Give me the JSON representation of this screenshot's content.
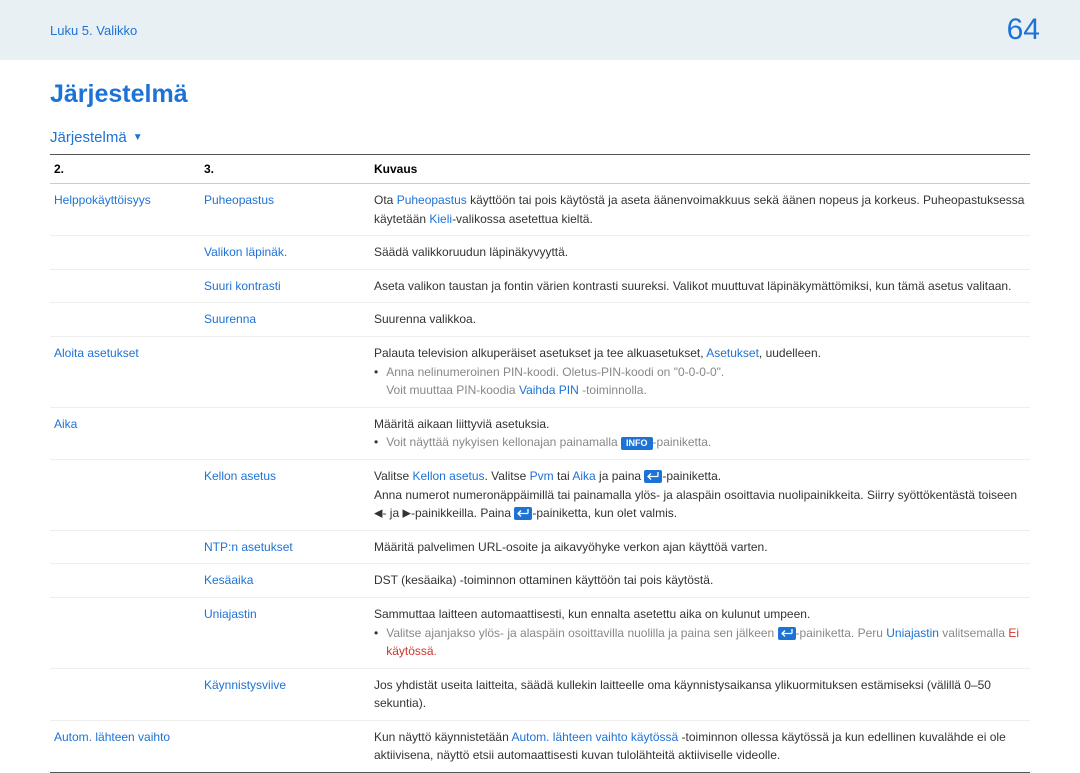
{
  "header": {
    "breadcrumb": "Luku 5. Valikko",
    "page": "64"
  },
  "title": "Järjestelmä",
  "section": "Järjestelmä",
  "table": {
    "head": {
      "c1": "2.",
      "c2": "3.",
      "c3": "Kuvaus"
    },
    "rows": {
      "helppo": {
        "c1": "Helppokäyttöisyys",
        "c2": "Puheopastus",
        "c3a": "Ota ",
        "c3b": "Puheopastus",
        "c3c": " käyttöön tai pois käytöstä ja aseta äänenvoimakkuus sekä äänen nopeus ja korkeus. Puheopastuksessa käytetään ",
        "c3d": "Kieli",
        "c3e": "-valikossa asetettua kieltä."
      },
      "valikon": {
        "c2": "Valikon läpinäk.",
        "c3": "Säädä valikkoruudun läpinäkyvyyttä."
      },
      "suurik": {
        "c2": "Suuri kontrasti",
        "c3": "Aseta valikon taustan ja fontin värien kontrasti suureksi. Valikot muuttuvat läpinäkymättömiksi, kun tämä asetus valitaan."
      },
      "suurenna": {
        "c2": "Suurenna",
        "c3": "Suurenna valikkoa."
      },
      "aloita": {
        "c1": "Aloita asetukset",
        "c3a": "Palauta television alkuperäiset asetukset ja tee alkuasetukset, ",
        "c3b": "Asetukset",
        "c3c": ", uudelleen.",
        "bul1": "Anna nelinumeroinen PIN-koodi. Oletus-PIN-koodi on \"0-0-0-0\".",
        "bul2a": "Voit muuttaa PIN-koodia ",
        "bul2b": "Vaihda PIN",
        "bul2c": " -toiminnolla."
      },
      "aika": {
        "c1": "Aika",
        "c3": "Määritä aikaan liittyviä asetuksia.",
        "bul1a": "Voit näyttää nykyisen kellonajan painamalla ",
        "bul1b": "INFO",
        "bul1c": "-painiketta."
      },
      "kellon": {
        "c2": "Kellon asetus",
        "c3a": "Valitse ",
        "c3b": "Kellon asetus",
        "c3c": ". Valitse ",
        "c3d": "Pvm",
        "c3e": " tai ",
        "c3f": "Aika",
        "c3g": " ja paina ",
        "c3h": "-painiketta.",
        "line2a": "Anna numerot numeronäppäimillä tai painamalla ylös- ja alaspäin osoittavia nuolipainikkeita. Siirry syöttökentästä toiseen ",
        "line2b": "- ja ",
        "line2c": "-painikkeilla. Paina ",
        "line2d": "-painiketta, kun olet valmis."
      },
      "ntp": {
        "c2": "NTP:n asetukset",
        "c3": "Määritä palvelimen URL-osoite ja aikavyöhyke verkon ajan käyttöä varten."
      },
      "kesa": {
        "c2": "Kesäaika",
        "c3": "DST (kesäaika) -toiminnon ottaminen käyttöön tai pois käytöstä."
      },
      "uni": {
        "c2": "Uniajastin",
        "c3": "Sammuttaa laitteen automaattisesti, kun ennalta asetettu aika on kulunut umpeen.",
        "bul1a": "Valitse ajanjakso ylös- ja alaspäin osoittavilla nuolilla ja paina sen jälkeen ",
        "bul1b": "-painiketta. Peru ",
        "bul1c": "Uniajastin",
        "bul1d": " valitsemalla ",
        "bul1e": "Ei käytössä",
        "bul1f": "."
      },
      "kayn": {
        "c2": "Käynnistysviive",
        "c3": "Jos yhdistät useita laitteita, säädä kullekin laitteelle oma käynnistysaikansa ylikuormituksen estämiseksi (välillä 0–50 sekuntia)."
      },
      "autom": {
        "c1": "Autom. lähteen vaihto",
        "c3a": "Kun näyttö käynnistetään ",
        "c3b": "Autom. lähteen vaihto käytössä",
        "c3c": " -toiminnon ollessa käytössä ja kun edellinen kuvalähde ei ole aktiivisena, näyttö etsii automaattisesti kuvan tulolähteitä aktiiviselle videolle."
      }
    }
  }
}
